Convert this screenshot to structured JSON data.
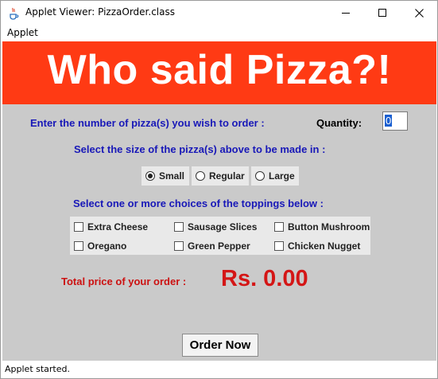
{
  "window": {
    "title": "Applet Viewer: PizzaOrder.class",
    "icon": "java-cup-icon"
  },
  "menu": {
    "applet_label": "Applet"
  },
  "banner": {
    "title": "Who said Pizza?!",
    "color": "#ff3a14"
  },
  "quantity": {
    "prompt": "Enter the number of pizza(s) you wish to order :",
    "label": "Quantity:",
    "value": "0"
  },
  "size": {
    "prompt": "Select the size of the pizza(s) above to be made in :",
    "options": [
      "Small",
      "Regular",
      "Large"
    ],
    "selected": "Small"
  },
  "toppings": {
    "prompt": "Select one or more choices of the toppings below :",
    "items": [
      "Extra Cheese",
      "Sausage Slices",
      "Button Mushroom",
      "Oregano",
      "Green Pepper",
      "Chicken Nugget"
    ],
    "checked": []
  },
  "total": {
    "label": "Total price of your order :",
    "price": "Rs. 0.00"
  },
  "order_button": "Order Now",
  "status": "Applet started.",
  "colors": {
    "applet_bg": "#cacaca",
    "prompt_text": "#1818b8",
    "price_text": "#d41616"
  }
}
